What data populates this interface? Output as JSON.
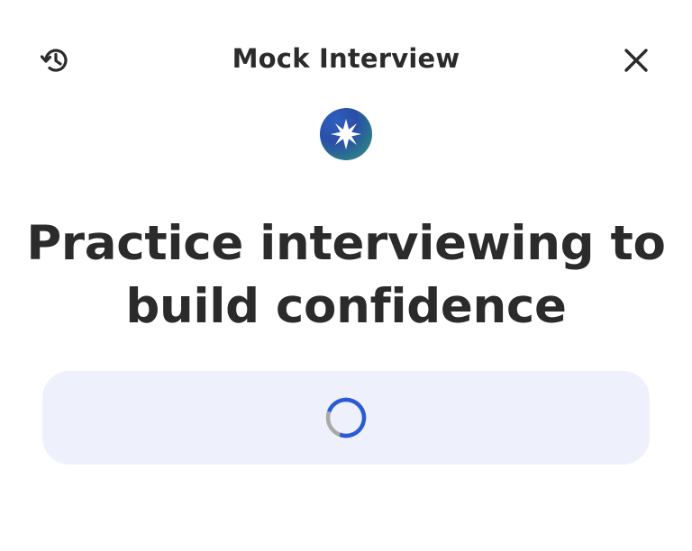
{
  "header": {
    "title": "Mock Interview",
    "history_icon": "history-icon",
    "close_icon": "close-icon"
  },
  "brand": {
    "icon": "sparkle-star-icon"
  },
  "main": {
    "headline_line1": "Practice interviewing to",
    "headline_line2": "build confidence"
  },
  "loading": {
    "icon": "loading-spinner-icon",
    "accent_color": "#2a5bd7",
    "track_color": "#a9a9a9",
    "panel_color": "#eef1fb"
  }
}
